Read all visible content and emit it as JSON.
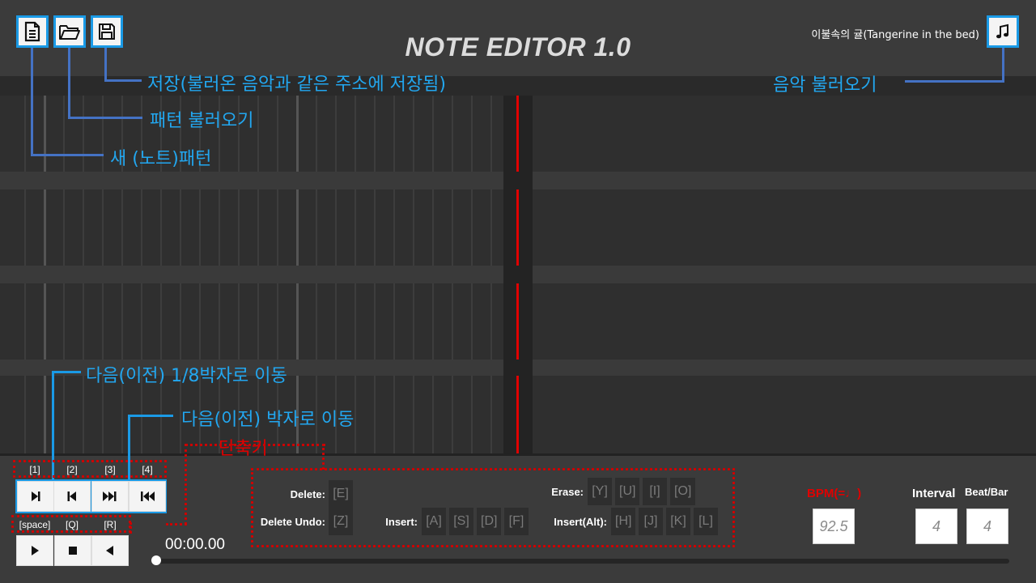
{
  "header": {
    "title": "NOTE EDITOR 1.0",
    "song_title": "이불속의 귤(Tangerine in the bed)"
  },
  "annotations": {
    "save": "저장(불러온 음악과 같은 주소에 저장됨)",
    "load_pattern": "패턴 불러오기",
    "new_pattern": "새 (노트)패턴",
    "load_music": "음악 불러오기",
    "move_eighth": "다음(이전) 1/8박자로 이동",
    "move_beat": "다음(이전) 박자로 이동",
    "shortcuts": "단축키"
  },
  "transport": {
    "nav_keys": [
      "[1]",
      "[2]",
      "[3]",
      "[4]"
    ],
    "play_keys": [
      "[space]",
      "[Q]",
      "[R]"
    ],
    "time": "00:00.00",
    "progress": 0
  },
  "shortcuts": {
    "delete_label": "Delete:",
    "delete_key": "[E]",
    "delete_undo_label": "Delete Undo:",
    "delete_undo_key": "[Z]",
    "insert_label": "Insert:",
    "insert_keys": [
      "[A]",
      "[S]",
      "[D]",
      "[F]"
    ],
    "erase_label": "Erase:",
    "erase_keys": [
      "[Y]",
      "[U]",
      "[I]",
      "[O]"
    ],
    "insert_alt_label": "Insert(Alt):",
    "insert_alt_keys": [
      "[H]",
      "[J]",
      "[K]",
      "[L]"
    ]
  },
  "settings": {
    "bpm_label": "BPM(=♩)",
    "bpm_value": "92.5",
    "interval_label": "Interval",
    "interval_value": "4",
    "beat_bar_label": "Beat/Bar",
    "beat_bar_value": "4"
  },
  "icons": {
    "new": "new-file-icon",
    "open": "folder-open-icon",
    "save": "save-icon",
    "music": "music-note-icon"
  },
  "colors": {
    "accent": "#1a9ae6",
    "annotation": "#22a7f0",
    "playhead": "#e00000",
    "bpm": "#e00000"
  }
}
